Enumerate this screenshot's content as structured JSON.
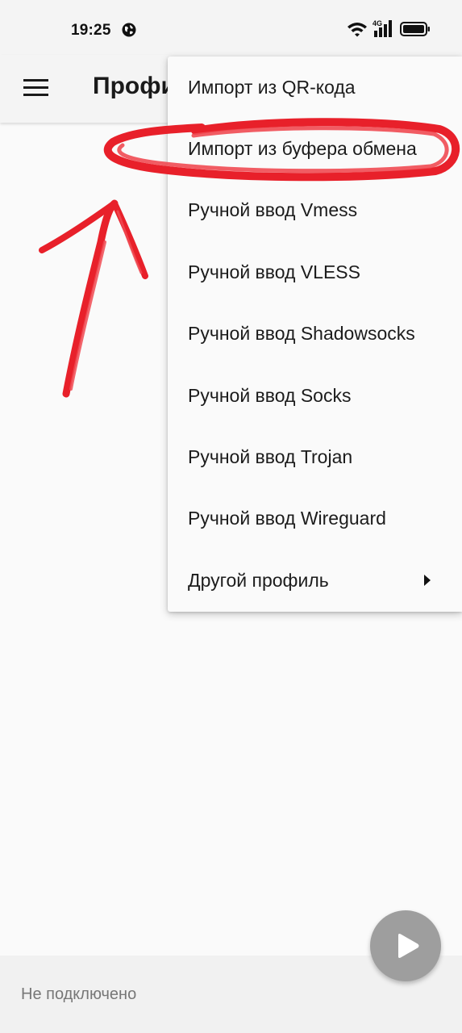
{
  "status_bar": {
    "time": "19:25",
    "network_label": "4G",
    "icons": [
      "globe-icon",
      "wifi-icon",
      "signal-icon",
      "battery-icon"
    ]
  },
  "app_bar": {
    "title": "Профи",
    "menu_icon": "menu-icon"
  },
  "dropdown": {
    "items": [
      {
        "label": "Импорт из QR-кода"
      },
      {
        "label": "Импорт из буфера обмена",
        "highlighted": true
      },
      {
        "label": "Ручной ввод Vmess"
      },
      {
        "label": "Ручной ввод VLESS"
      },
      {
        "label": "Ручной ввод Shadowsocks"
      },
      {
        "label": "Ручной ввод Socks"
      },
      {
        "label": "Ручной ввод Trojan"
      },
      {
        "label": "Ручной ввод Wireguard"
      },
      {
        "label": "Другой профиль",
        "has_submenu": true
      }
    ]
  },
  "footer": {
    "status_text": "Не подключено"
  },
  "fab": {
    "icon": "play-icon"
  },
  "colors": {
    "annotation": "#e8202a",
    "fab_background": "#9e9e9e",
    "app_bar_background": "#f4f4f4",
    "page_background": "#fafafa"
  }
}
